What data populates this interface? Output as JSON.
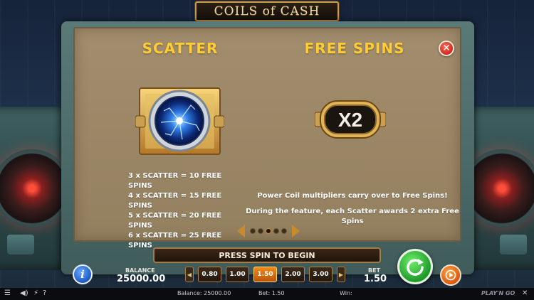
{
  "game": {
    "logo_text": "COILS of CASH"
  },
  "info_panel": {
    "left_title": "SCATTER",
    "right_title": "FREE SPINS",
    "multiplier_symbol": "X2",
    "scatter_rules": [
      "3 x SCATTER = 10 FREE SPINS",
      "4 x SCATTER = 15 FREE SPINS",
      "5 x SCATTER = 20 FREE SPINS",
      "6 x SCATTER = 25 FREE SPINS"
    ],
    "free_spin_notes": [
      "Power Coil multipliers carry over to Free Spins!",
      "During the feature, each Scatter awards 2 extra Free Spins"
    ],
    "close_icon": "close-icon",
    "pager": {
      "pages": 5,
      "current": 3
    }
  },
  "controls": {
    "banner": "PRESS SPIN TO BEGIN",
    "balance_label": "BALANCE",
    "balance_value": "25000.00",
    "bet_label": "BET",
    "bet_value": "1.50",
    "bet_options": [
      "0.80",
      "1.00",
      "1.50",
      "2.00",
      "3.00"
    ],
    "selected_bet": "1.50",
    "info_icon": "i",
    "spin_icon": "spin-icon",
    "autoplay_icon": "autoplay-icon"
  },
  "status_bar": {
    "balance_text": "Balance: 25000.00",
    "bet_text": "Bet: 1.50",
    "win_text": "Win:",
    "help_text": "?",
    "brand": "PLAY'N GO"
  },
  "colors": {
    "title_yellow": "#ffcc33",
    "panel_tan": "#9b8766",
    "spin_green": "#1d9a2a",
    "bet_selected": "#f08a1a",
    "close_red": "#d4261d"
  }
}
